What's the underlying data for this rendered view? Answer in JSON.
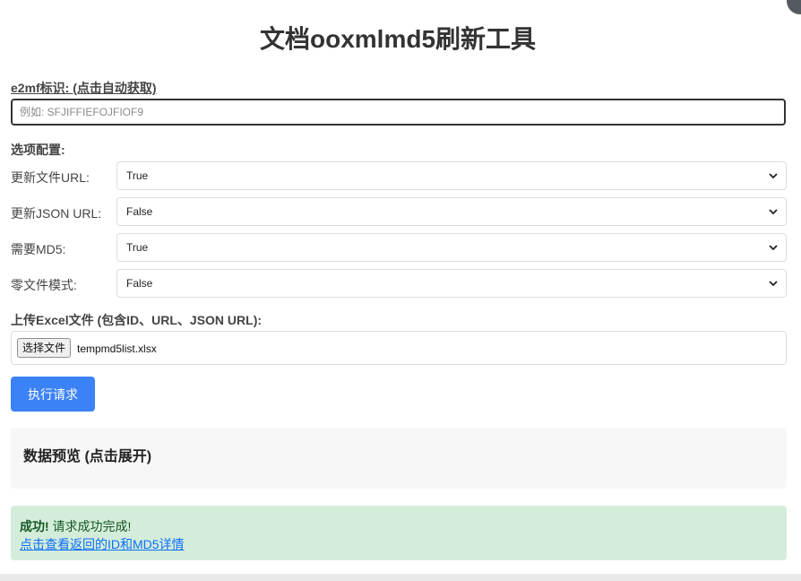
{
  "title": "文档ooxmlmd5刷新工具",
  "e2mf": {
    "label": "e2mf标识: (点击自动获取)",
    "placeholder": "例如: SFJIFFIEFOJFIOF9",
    "value": ""
  },
  "options": {
    "heading": "选项配置:",
    "rows": [
      {
        "label": "更新文件URL:",
        "value": "True"
      },
      {
        "label": "更新JSON URL:",
        "value": "False"
      },
      {
        "label": "需要MD5:",
        "value": "True"
      },
      {
        "label": "零文件模式:",
        "value": "False"
      }
    ]
  },
  "upload": {
    "heading": "上传Excel文件 (包含ID、URL、JSON URL):",
    "button_label": "选择文件",
    "file_name": "tempmd5list.xlsx"
  },
  "execute": {
    "label": "执行请求"
  },
  "preview": {
    "title": "数据预览 (点击展开)"
  },
  "result": {
    "success_strong": "成功!",
    "success_text": " 请求成功完成!",
    "link_text": "点击查看返回的ID和MD5详情"
  },
  "colors": {
    "primary_button": "#3b82f6",
    "success_bg": "#d4edda",
    "success_text": "#155724",
    "link": "#0d6efd"
  },
  "icons": {
    "select_arrow": "chevron-down-icon"
  }
}
